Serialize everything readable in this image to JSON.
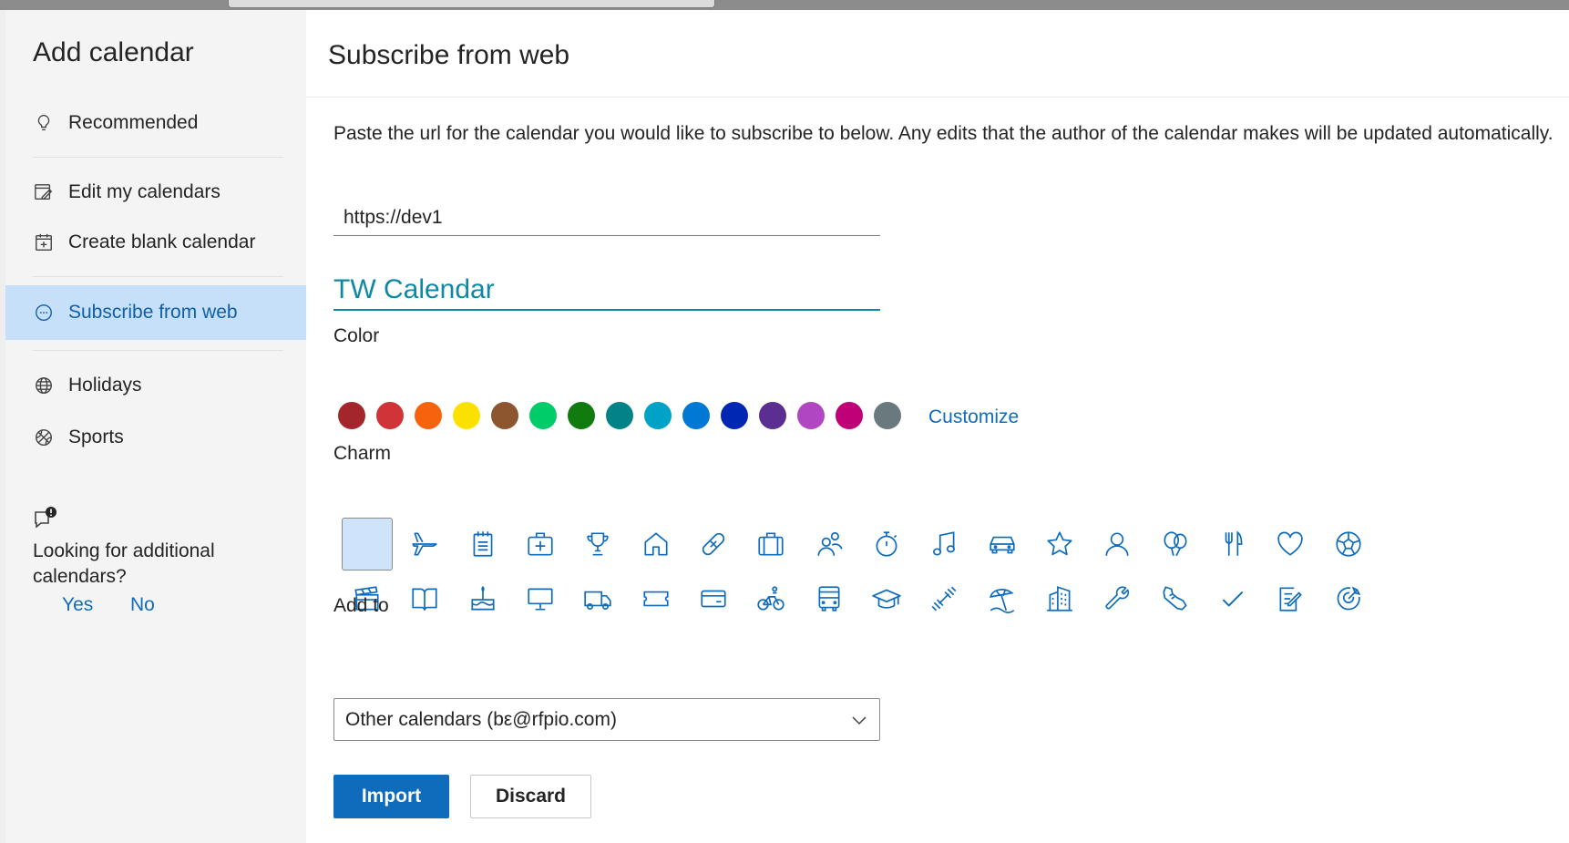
{
  "sidebar": {
    "title": "Add calendar",
    "items": [
      {
        "id": "recommended",
        "label": "Recommended",
        "icon": "lightbulb-icon"
      },
      {
        "id": "edit",
        "label": "Edit my calendars",
        "icon": "edit-calendar-icon"
      },
      {
        "id": "blank",
        "label": "Create blank calendar",
        "icon": "calendar-add-icon"
      },
      {
        "id": "web",
        "label": "Subscribe from web",
        "icon": "link-circle-icon"
      },
      {
        "id": "holidays",
        "label": "Holidays",
        "icon": "globe-icon"
      },
      {
        "id": "sports",
        "label": "Sports",
        "icon": "basketball-icon"
      }
    ],
    "help": {
      "text": "Looking for additional calendars?",
      "yes": "Yes",
      "no": "No",
      "icon": "chat-alert-icon"
    }
  },
  "main": {
    "title": "Subscribe from web",
    "description": "Paste the url for the calendar you would like to subscribe to below. Any edits that the author of the calendar makes will be updated automatically.",
    "url_value": "https://dev1",
    "calendar_name": "TW Calendar",
    "color_label": "Color",
    "colors": [
      "#a4262c",
      "#d13438",
      "#f7630c",
      "#fce100",
      "#8e562e",
      "#00cc6a",
      "#107c10",
      "#038387",
      "#00a2c8",
      "#0078d4",
      "#0027b4",
      "#5c2e91",
      "#b146c2",
      "#bf0077",
      "#69797e"
    ],
    "customize_label": "Customize",
    "charm_label": "Charm",
    "charms_row1": [
      "none",
      "airplane-icon",
      "notepad-icon",
      "medical-kit-icon",
      "trophy-icon",
      "home-icon",
      "bandage-icon",
      "briefcase-icon",
      "people-icon",
      "stopwatch-icon",
      "music-note-icon",
      "car-icon",
      "star-icon",
      "person-icon",
      "balloon-icon",
      "fork-knife-icon",
      "heart-icon",
      "soccer-ball-icon"
    ],
    "charms_row2": [
      "clapperboard-icon",
      "book-icon",
      "cake-icon",
      "monitor-icon",
      "truck-icon",
      "ticket-icon",
      "credit-card-icon",
      "bicycle-icon",
      "bus-icon",
      "graduation-cap-icon",
      "dumbbell-icon",
      "beach-icon",
      "building-icon",
      "wrench-icon",
      "sneaker-icon",
      "checkmark-icon",
      "note-edit-icon",
      "target-icon"
    ],
    "addto_label": "Add to",
    "addto_value": "Other calendars (bε@rfpio.com)",
    "import_label": "Import",
    "discard_label": "Discard"
  }
}
